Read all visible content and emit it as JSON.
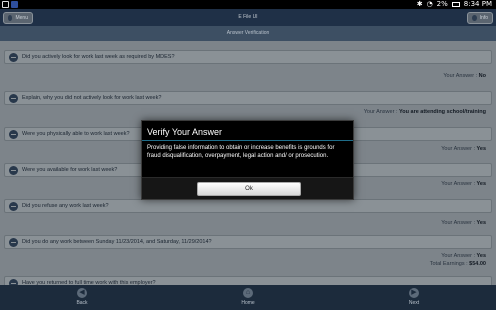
{
  "status_bar": {
    "battery": "2%",
    "time": "8:34 PM"
  },
  "header": {
    "menu_label": "Menu",
    "title": "E File UI",
    "info_label": "Info"
  },
  "subheader": {
    "title": "Answer Verification"
  },
  "questions": [
    {
      "text": "Did you actively look for work last week as required by MDES?",
      "answer_label": "Your Answer : ",
      "answer": "No"
    },
    {
      "text": "Explain, why you did not actively look for work last week?",
      "answer_label": "Your Answer : ",
      "answer": "You are attending school/training"
    },
    {
      "text": "Were you physically able to work last week?",
      "answer_label": "Your Answer : ",
      "answer": "Yes"
    },
    {
      "text": "Were you available for work last week?",
      "answer_label": "Your Answer : ",
      "answer": "Yes"
    },
    {
      "text": "Did you refuse any work last week?",
      "answer_label": "Your Answer : ",
      "answer": "Yes"
    },
    {
      "text": "Did you do any work between Sunday 11/23/2014, and Saturday, 11/29/2014?",
      "answer_label": "Your Answer : ",
      "answer": "Yes",
      "earnings_label": "Total Earnings : ",
      "earnings": "$54.00"
    },
    {
      "text": "Have you returned to full time work with this employer?"
    }
  ],
  "bottom_nav": {
    "back": "Back",
    "home": "Home",
    "next": "Next"
  },
  "dialog": {
    "title": "Verify Your Answer",
    "body": "Providing false information to obtain or increase benefits is grounds for fraud disqualification, overpayment, legal action and/ or prosecution.",
    "ok_label": "Ok"
  },
  "colors": {
    "accent": "#33b5e5",
    "header_bg": "#1f3047",
    "dialog_bg": "#000000"
  }
}
